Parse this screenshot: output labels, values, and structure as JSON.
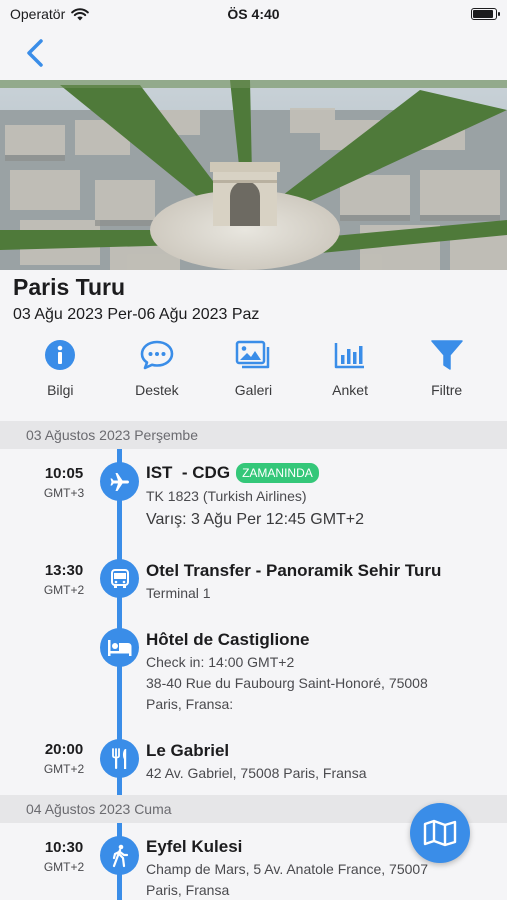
{
  "status_bar": {
    "carrier": "Operatör",
    "time": "ÖS 4:40"
  },
  "tour": {
    "title": "Paris Turu",
    "dates": "03 Ağu 2023 Per-06 Ağu 2023 Paz"
  },
  "actions": [
    {
      "label": "Bilgi",
      "icon": "info-icon"
    },
    {
      "label": "Destek",
      "icon": "chat-bubble-icon"
    },
    {
      "label": "Galeri",
      "icon": "gallery-icon"
    },
    {
      "label": "Anket",
      "icon": "bar-chart-icon"
    },
    {
      "label": "Filtre",
      "icon": "filter-icon"
    }
  ],
  "days": [
    {
      "label": "03 Ağustos 2023 Perşembe"
    },
    {
      "label": "04 Ağustos 2023 Cuma"
    }
  ],
  "items": [
    {
      "time": "10:05",
      "tz": "GMT+3",
      "icon": "airplane-icon",
      "title": "IST  - CDG",
      "badge": "ZAMANINDA",
      "lines": [
        "TK 1823 (Turkish Airlines)",
        "Varış: 3 Ağu Per 12:45 GMT+2"
      ]
    },
    {
      "time": "13:30",
      "tz": "GMT+2",
      "icon": "bus-icon",
      "title": "Otel Transfer - Panoramik Sehir Turu",
      "lines": [
        "Terminal 1"
      ]
    },
    {
      "time": "",
      "tz": "",
      "icon": "bed-icon",
      "title": "Hôtel de Castiglione",
      "lines": [
        "Check in: 14:00 GMT+2",
        "38-40 Rue du Faubourg Saint-Honoré, 75008",
        "Paris, Fransa:"
      ]
    },
    {
      "time": "20:00",
      "tz": "GMT+2",
      "icon": "restaurant-icon",
      "title": "Le Gabriel",
      "lines": [
        "42 Av. Gabriel, 75008 Paris, Fransa"
      ]
    },
    {
      "time": "10:30",
      "tz": "GMT+2",
      "icon": "walking-icon",
      "title": "Eyfel Kulesi",
      "lines": [
        "Champ de Mars, 5 Av. Anatole France, 75007",
        "Paris, Fransa"
      ]
    }
  ],
  "fab": {
    "icon": "map-icon"
  },
  "colors": {
    "accent": "#3a8de8",
    "badge": "#34c779",
    "day_header_bg": "#e6e6e8"
  }
}
